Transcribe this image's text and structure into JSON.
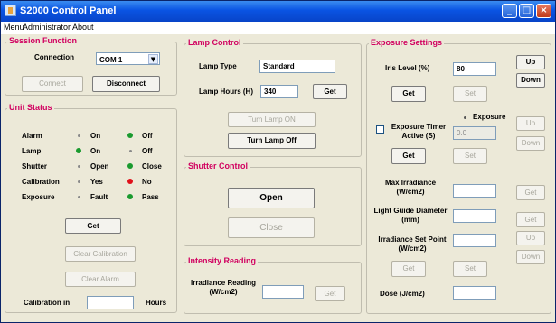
{
  "window": {
    "title": "S2000 Control Panel",
    "min_glyph": "_",
    "max_glyph": "□",
    "close_glyph": "×"
  },
  "menu": {
    "items": [
      "Menu",
      "Administrator",
      "About"
    ]
  },
  "session": {
    "title": "Session Function",
    "connection_label": "Connection",
    "com_value": "COM 1",
    "connect": "Connect",
    "disconnect": "Disconnect"
  },
  "unit_status": {
    "title": "Unit Status",
    "rows": [
      {
        "label": "Alarm",
        "left": "On",
        "right": "Off",
        "left_active": false,
        "right_active": true,
        "right_color": "#1a9a2e"
      },
      {
        "label": "Lamp",
        "left": "On",
        "right": "Off",
        "left_active": true,
        "right_active": false,
        "left_color": "#1a9a2e"
      },
      {
        "label": "Shutter",
        "left": "Open",
        "right": "Close",
        "left_active": false,
        "right_active": true,
        "right_color": "#1a9a2e"
      },
      {
        "label": "Calibration",
        "left": "Yes",
        "right": "No",
        "left_active": false,
        "right_active": true,
        "right_color": "#e0101a"
      },
      {
        "label": "Exposure",
        "left": "Fault",
        "right": "Pass",
        "left_active": false,
        "right_active": true,
        "right_color": "#1a9a2e"
      }
    ],
    "get": "Get",
    "clear_calibration": "Clear Calibration",
    "clear_alarm": "Clear Alarm",
    "calibration_in": "Calibration in",
    "calibration_value": "",
    "hours": "Hours"
  },
  "lamp": {
    "title": "Lamp Control",
    "type_label": "Lamp Type",
    "type_value": "Standard",
    "hours_label": "Lamp Hours (H)",
    "hours_value": "340",
    "get": "Get",
    "turn_on": "Turn Lamp ON",
    "turn_off": "Turn Lamp Off"
  },
  "shutter": {
    "title": "Shutter Control",
    "open": "Open",
    "close": "Close"
  },
  "intensity": {
    "title": "Intensity Reading",
    "label": "Irradiance Reading (W/cm2)",
    "value": "",
    "get": "Get"
  },
  "exposure": {
    "title": "Exposure Settings",
    "iris_label": "Iris Level (%)",
    "iris_value": "80",
    "up": "Up",
    "down": "Down",
    "get": "Get",
    "set": "Set",
    "exposure_radio": "Exposure",
    "timer_label": "Exposure Timer Active (S)",
    "timer_value": "0.0",
    "max_irr_label": "Max Irradiance (W/cm2)",
    "light_guide_label": "Light Guide Diameter (mm)",
    "set_point_label": "Irradiance Set Point (W/cm2)",
    "dose_label": "Dose (J/cm2)",
    "max_irr_value": "",
    "light_guide_value": "",
    "set_point_value": "",
    "dose_value": ""
  },
  "colors": {
    "accent_title": "#d1005f",
    "on_green": "#1a9a2e",
    "no_red": "#e0101a"
  }
}
